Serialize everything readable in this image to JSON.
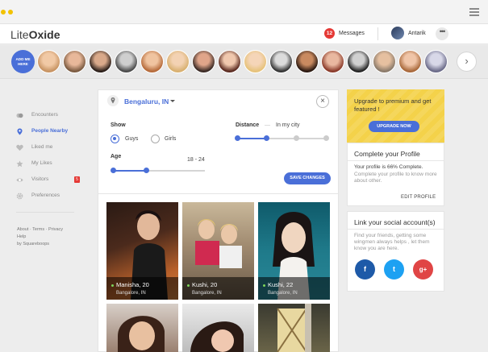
{
  "app": {
    "logo_light": "Lite",
    "logo_bold": "Oxide"
  },
  "header": {
    "messages_count": "12",
    "messages_label": "Messages",
    "user_name": "Antarik",
    "more_label": "•••"
  },
  "strip": {
    "add_me_label": "ADD ME HERE",
    "next_label": "›"
  },
  "nav": {
    "items": [
      {
        "label": "Encounters",
        "icon": "encounters-icon"
      },
      {
        "label": "People Nearby",
        "icon": "location-pin-icon",
        "active": true
      },
      {
        "label": "Liked me",
        "icon": "heart-icon"
      },
      {
        "label": "My Likes",
        "icon": "star-icon"
      },
      {
        "label": "Visitors",
        "icon": "eye-icon",
        "badge": "5"
      },
      {
        "label": "Preferences",
        "icon": "gear-icon"
      }
    ],
    "footer_line1": "About · Terms · Privacy",
    "footer_line2": "Help",
    "footer_line3": "by Squareboops"
  },
  "filters": {
    "location": "Bengaluru, IN",
    "close_label": "×",
    "show_label": "Show",
    "option_guys": "Guys",
    "option_girls": "Girls",
    "selected_option": "Guys",
    "distance_label": "Distance",
    "distance_dash": "—",
    "distance_value": "In my city",
    "distance_level": 0.33,
    "age_label": "Age",
    "age_range": "18 - 24",
    "age_level": 0.36,
    "save_label": "SAVE CHANGES"
  },
  "profiles": [
    {
      "name": "Manisha, 20",
      "city": "Bangalore, IN"
    },
    {
      "name": "Kushi, 20",
      "city": "Bangalore, IN"
    },
    {
      "name": "Kushi, 22",
      "city": "Bangalore, IN"
    },
    {
      "name": "",
      "city": ""
    },
    {
      "name": "",
      "city": ""
    },
    {
      "name": "",
      "city": ""
    }
  ],
  "premium": {
    "text": "Upgrade to premium and get featured !",
    "button": "UPGRADE NOW"
  },
  "profile_card": {
    "title": "Complete your Profile",
    "status": "Your profile is 66% Complete.",
    "subtext": "Complete your profile to know more about other.",
    "edit_label": "EDIT PROFILE",
    "completion": 0.66
  },
  "social_card": {
    "title": "Link your social account(s)",
    "text": "Find your friends, getting some wingmen always helps , let them know you are here.",
    "facebook_label": "f",
    "twitter_label": "t",
    "google_label": "g+"
  },
  "colors": {
    "accent": "#4a6fd8",
    "premium_bg": "#f4d24a",
    "badge": "#e53935",
    "facebook": "#1e5aa8",
    "twitter": "#1da1f2",
    "google": "#e04545"
  }
}
